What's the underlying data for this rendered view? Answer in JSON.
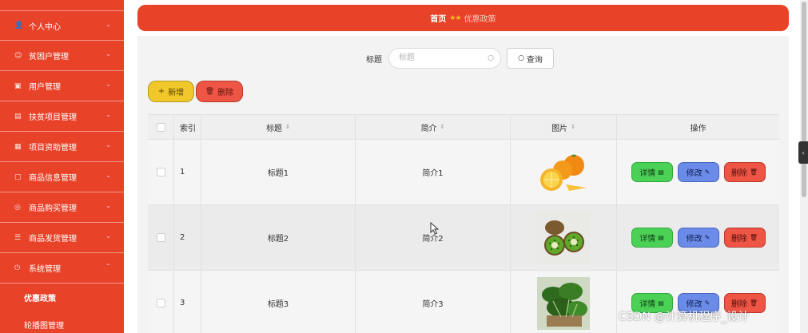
{
  "sidebar": {
    "items": [
      {
        "label": "个人中心",
        "icon": "user-icon",
        "glyph": "👤"
      },
      {
        "label": "贫困户管理",
        "icon": "users-icon",
        "glyph": "☺"
      },
      {
        "label": "用户管理",
        "icon": "user-group-icon",
        "glyph": "▣"
      },
      {
        "label": "扶贫项目管理",
        "icon": "folder-icon",
        "glyph": "▤"
      },
      {
        "label": "项目资助管理",
        "icon": "grid-icon",
        "glyph": "▦"
      },
      {
        "label": "商品信息管理",
        "icon": "box-icon",
        "glyph": "▢"
      },
      {
        "label": "商品购买管理",
        "icon": "cart-icon",
        "glyph": "◎"
      },
      {
        "label": "商品发货管理",
        "icon": "list-icon",
        "glyph": "☰"
      },
      {
        "label": "系统管理",
        "icon": "power-icon",
        "glyph": "⏻"
      }
    ],
    "subitems": [
      {
        "label": "优惠政策"
      },
      {
        "label": "轮播图管理"
      }
    ]
  },
  "breadcrumb": {
    "home": "首页",
    "separator": "★★",
    "current": "优惠政策"
  },
  "search": {
    "label": "标题",
    "placeholder": "标题",
    "button_label": "查询"
  },
  "toolbar": {
    "add_label": "新增",
    "delete_label": "删除"
  },
  "table": {
    "headers": {
      "index": "索引",
      "title": "标题",
      "brief": "简介",
      "image": "图片",
      "ops": "操作"
    },
    "rows": [
      {
        "index": "1",
        "title": "标题1",
        "brief": "简介1",
        "image": "oranges"
      },
      {
        "index": "2",
        "title": "标题2",
        "brief": "简介2",
        "image": "kiwis"
      },
      {
        "index": "3",
        "title": "标题3",
        "brief": "简介3",
        "image": "spinach"
      }
    ],
    "op_labels": {
      "detail": "详情",
      "edit": "修改",
      "delete": "删除"
    }
  },
  "watermark": "CSDN @计算机程序_设计",
  "colors": {
    "primary": "#e84229",
    "add_button": "#f0c82b",
    "detail_button": "#4cd157",
    "edit_button": "#6b8be8",
    "delete_button": "#ef5545"
  }
}
